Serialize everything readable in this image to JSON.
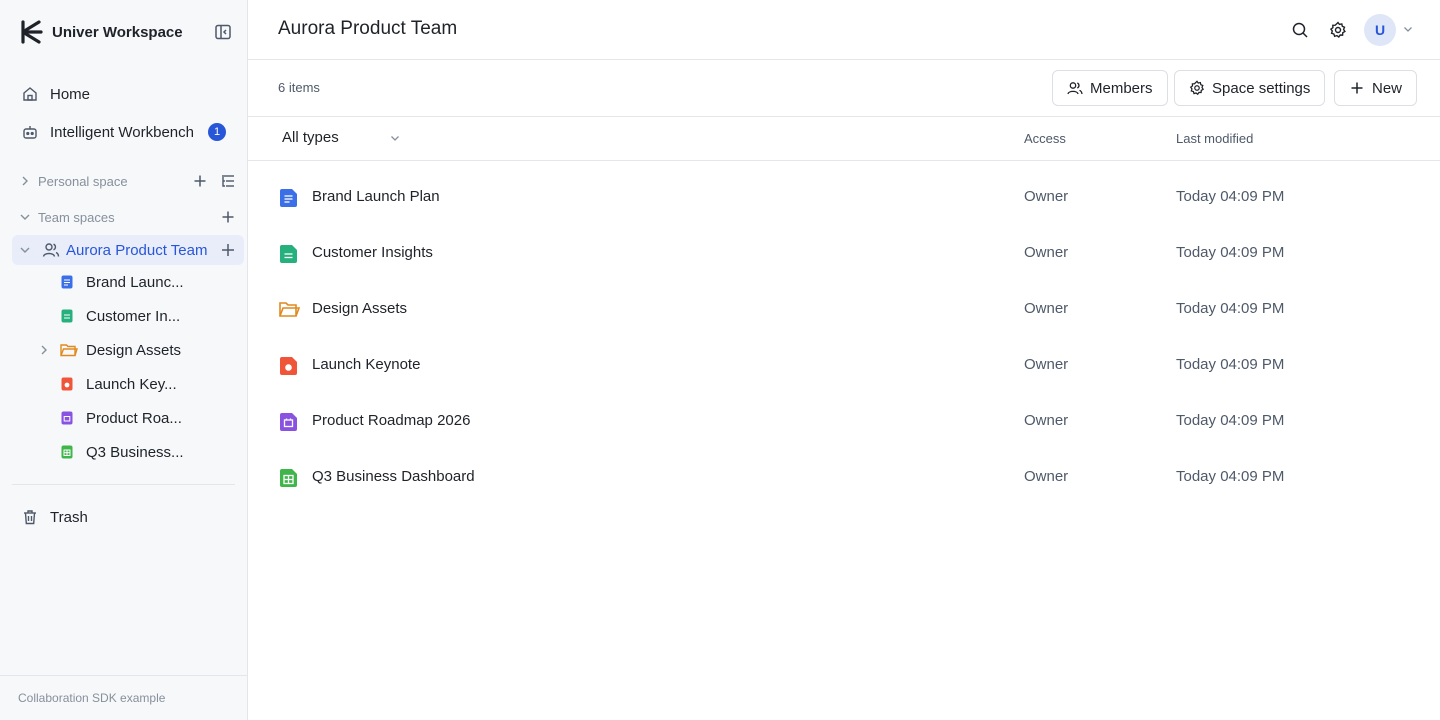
{
  "sidebar": {
    "brand": "Univer Workspace",
    "nav": [
      {
        "label": "Home",
        "icon": "home-icon"
      },
      {
        "label": "Intelligent Workbench",
        "icon": "robot-icon",
        "badge": "1"
      }
    ],
    "personal_space": "Personal space",
    "team_spaces": "Team spaces",
    "team": {
      "label": "Aurora Product Team",
      "icon": "team-icon"
    },
    "tree": [
      {
        "label": "Brand Launc...",
        "type": "doc"
      },
      {
        "label": "Customer In...",
        "type": "sheet"
      },
      {
        "label": "Design Assets",
        "type": "folder"
      },
      {
        "label": "Launch Key...",
        "type": "slide"
      },
      {
        "label": "Product Roa...",
        "type": "board"
      },
      {
        "label": "Q3 Business...",
        "type": "table"
      }
    ],
    "trash": "Trash",
    "footer": "Collaboration SDK example"
  },
  "header": {
    "title": "Aurora Product Team",
    "avatar": "U"
  },
  "toolbar": {
    "count": "6 items",
    "members": "Members",
    "space_settings": "Space settings",
    "new": "New"
  },
  "table": {
    "filter": "All types",
    "columns": {
      "access": "Access",
      "modified": "Last modified"
    },
    "rows": [
      {
        "name": "Brand Launch Plan",
        "type": "doc",
        "access": "Owner",
        "modified": "Today 04:09 PM"
      },
      {
        "name": "Customer Insights",
        "type": "sheet",
        "access": "Owner",
        "modified": "Today 04:09 PM"
      },
      {
        "name": "Design Assets",
        "type": "folder",
        "access": "Owner",
        "modified": "Today 04:09 PM"
      },
      {
        "name": "Launch Keynote",
        "type": "slide",
        "access": "Owner",
        "modified": "Today 04:09 PM"
      },
      {
        "name": "Product Roadmap 2026",
        "type": "board",
        "access": "Owner",
        "modified": "Today 04:09 PM"
      },
      {
        "name": "Q3 Business Dashboard",
        "type": "table",
        "access": "Owner",
        "modified": "Today 04:09 PM"
      }
    ]
  },
  "colors": {
    "accent": "#2856d8",
    "doc": "#3b6fe8",
    "sheet": "#26b07e",
    "folder": "#e08a1e",
    "slide": "#f0553a",
    "board": "#8a52e0",
    "table": "#3fb54a"
  }
}
